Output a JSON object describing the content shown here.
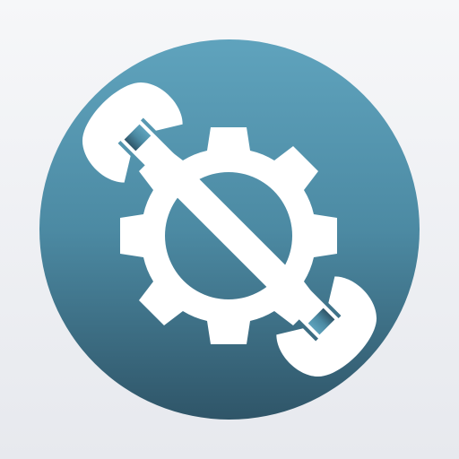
{
  "app_icon": {
    "icon_name": "settings-gear-wrench-icon",
    "glyphs": [
      "gear",
      "wrench"
    ],
    "colors": {
      "background_top": "#f6f7f9",
      "background_bottom": "#e7e9ee",
      "circle_top": "#5fa3bd",
      "circle_mid": "#4c8aa3",
      "circle_bottom": "#2f5568",
      "glyph": "#ffffff"
    }
  }
}
